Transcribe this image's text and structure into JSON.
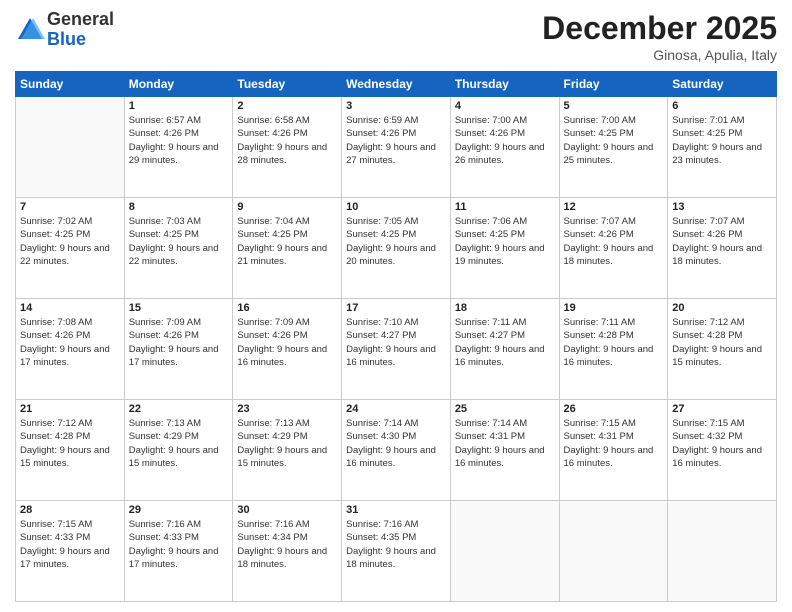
{
  "logo": {
    "general": "General",
    "blue": "Blue"
  },
  "header": {
    "month": "December 2025",
    "location": "Ginosa, Apulia, Italy"
  },
  "days_of_week": [
    "Sunday",
    "Monday",
    "Tuesday",
    "Wednesday",
    "Thursday",
    "Friday",
    "Saturday"
  ],
  "weeks": [
    [
      {
        "num": "",
        "empty": true
      },
      {
        "num": "1",
        "sunrise": "Sunrise: 6:57 AM",
        "sunset": "Sunset: 4:26 PM",
        "daylight": "Daylight: 9 hours and 29 minutes."
      },
      {
        "num": "2",
        "sunrise": "Sunrise: 6:58 AM",
        "sunset": "Sunset: 4:26 PM",
        "daylight": "Daylight: 9 hours and 28 minutes."
      },
      {
        "num": "3",
        "sunrise": "Sunrise: 6:59 AM",
        "sunset": "Sunset: 4:26 PM",
        "daylight": "Daylight: 9 hours and 27 minutes."
      },
      {
        "num": "4",
        "sunrise": "Sunrise: 7:00 AM",
        "sunset": "Sunset: 4:26 PM",
        "daylight": "Daylight: 9 hours and 26 minutes."
      },
      {
        "num": "5",
        "sunrise": "Sunrise: 7:00 AM",
        "sunset": "Sunset: 4:25 PM",
        "daylight": "Daylight: 9 hours and 25 minutes."
      },
      {
        "num": "6",
        "sunrise": "Sunrise: 7:01 AM",
        "sunset": "Sunset: 4:25 PM",
        "daylight": "Daylight: 9 hours and 23 minutes."
      }
    ],
    [
      {
        "num": "7",
        "sunrise": "Sunrise: 7:02 AM",
        "sunset": "Sunset: 4:25 PM",
        "daylight": "Daylight: 9 hours and 22 minutes."
      },
      {
        "num": "8",
        "sunrise": "Sunrise: 7:03 AM",
        "sunset": "Sunset: 4:25 PM",
        "daylight": "Daylight: 9 hours and 22 minutes."
      },
      {
        "num": "9",
        "sunrise": "Sunrise: 7:04 AM",
        "sunset": "Sunset: 4:25 PM",
        "daylight": "Daylight: 9 hours and 21 minutes."
      },
      {
        "num": "10",
        "sunrise": "Sunrise: 7:05 AM",
        "sunset": "Sunset: 4:25 PM",
        "daylight": "Daylight: 9 hours and 20 minutes."
      },
      {
        "num": "11",
        "sunrise": "Sunrise: 7:06 AM",
        "sunset": "Sunset: 4:25 PM",
        "daylight": "Daylight: 9 hours and 19 minutes."
      },
      {
        "num": "12",
        "sunrise": "Sunrise: 7:07 AM",
        "sunset": "Sunset: 4:26 PM",
        "daylight": "Daylight: 9 hours and 18 minutes."
      },
      {
        "num": "13",
        "sunrise": "Sunrise: 7:07 AM",
        "sunset": "Sunset: 4:26 PM",
        "daylight": "Daylight: 9 hours and 18 minutes."
      }
    ],
    [
      {
        "num": "14",
        "sunrise": "Sunrise: 7:08 AM",
        "sunset": "Sunset: 4:26 PM",
        "daylight": "Daylight: 9 hours and 17 minutes."
      },
      {
        "num": "15",
        "sunrise": "Sunrise: 7:09 AM",
        "sunset": "Sunset: 4:26 PM",
        "daylight": "Daylight: 9 hours and 17 minutes."
      },
      {
        "num": "16",
        "sunrise": "Sunrise: 7:09 AM",
        "sunset": "Sunset: 4:26 PM",
        "daylight": "Daylight: 9 hours and 16 minutes."
      },
      {
        "num": "17",
        "sunrise": "Sunrise: 7:10 AM",
        "sunset": "Sunset: 4:27 PM",
        "daylight": "Daylight: 9 hours and 16 minutes."
      },
      {
        "num": "18",
        "sunrise": "Sunrise: 7:11 AM",
        "sunset": "Sunset: 4:27 PM",
        "daylight": "Daylight: 9 hours and 16 minutes."
      },
      {
        "num": "19",
        "sunrise": "Sunrise: 7:11 AM",
        "sunset": "Sunset: 4:28 PM",
        "daylight": "Daylight: 9 hours and 16 minutes."
      },
      {
        "num": "20",
        "sunrise": "Sunrise: 7:12 AM",
        "sunset": "Sunset: 4:28 PM",
        "daylight": "Daylight: 9 hours and 15 minutes."
      }
    ],
    [
      {
        "num": "21",
        "sunrise": "Sunrise: 7:12 AM",
        "sunset": "Sunset: 4:28 PM",
        "daylight": "Daylight: 9 hours and 15 minutes."
      },
      {
        "num": "22",
        "sunrise": "Sunrise: 7:13 AM",
        "sunset": "Sunset: 4:29 PM",
        "daylight": "Daylight: 9 hours and 15 minutes."
      },
      {
        "num": "23",
        "sunrise": "Sunrise: 7:13 AM",
        "sunset": "Sunset: 4:29 PM",
        "daylight": "Daylight: 9 hours and 15 minutes."
      },
      {
        "num": "24",
        "sunrise": "Sunrise: 7:14 AM",
        "sunset": "Sunset: 4:30 PM",
        "daylight": "Daylight: 9 hours and 16 minutes."
      },
      {
        "num": "25",
        "sunrise": "Sunrise: 7:14 AM",
        "sunset": "Sunset: 4:31 PM",
        "daylight": "Daylight: 9 hours and 16 minutes."
      },
      {
        "num": "26",
        "sunrise": "Sunrise: 7:15 AM",
        "sunset": "Sunset: 4:31 PM",
        "daylight": "Daylight: 9 hours and 16 minutes."
      },
      {
        "num": "27",
        "sunrise": "Sunrise: 7:15 AM",
        "sunset": "Sunset: 4:32 PM",
        "daylight": "Daylight: 9 hours and 16 minutes."
      }
    ],
    [
      {
        "num": "28",
        "sunrise": "Sunrise: 7:15 AM",
        "sunset": "Sunset: 4:33 PM",
        "daylight": "Daylight: 9 hours and 17 minutes."
      },
      {
        "num": "29",
        "sunrise": "Sunrise: 7:16 AM",
        "sunset": "Sunset: 4:33 PM",
        "daylight": "Daylight: 9 hours and 17 minutes."
      },
      {
        "num": "30",
        "sunrise": "Sunrise: 7:16 AM",
        "sunset": "Sunset: 4:34 PM",
        "daylight": "Daylight: 9 hours and 18 minutes."
      },
      {
        "num": "31",
        "sunrise": "Sunrise: 7:16 AM",
        "sunset": "Sunset: 4:35 PM",
        "daylight": "Daylight: 9 hours and 18 minutes."
      },
      {
        "num": "",
        "empty": true
      },
      {
        "num": "",
        "empty": true
      },
      {
        "num": "",
        "empty": true
      }
    ]
  ]
}
